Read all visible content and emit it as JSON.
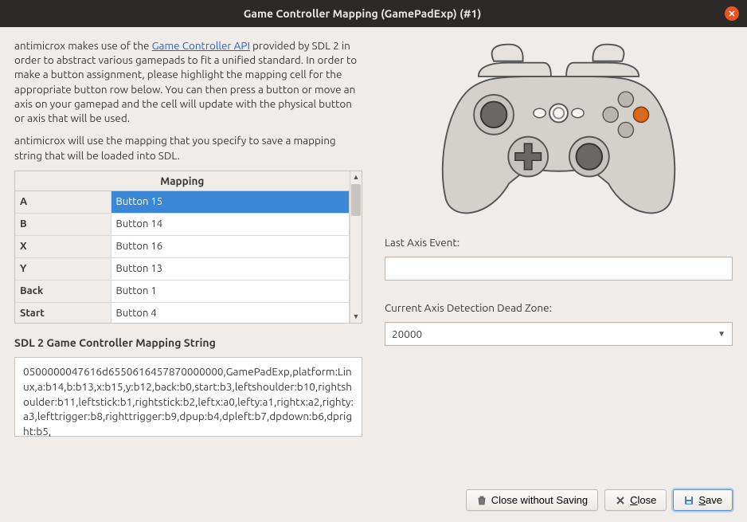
{
  "window": {
    "title": "Game Controller Mapping (GamePadExp) (#1)"
  },
  "intro": {
    "part1": "antimicrox makes use of the ",
    "link": "Game Controller API",
    "part2": " provided by SDL 2 in order to abstract various gamepads to fit a unified standard. In order to make a button assignment, please highlight the mapping cell for the appropriate button row below. You can then press a button or move an axis on your gamepad and the cell will update with the physical button or axis that will be used.",
    "part3": "antimicrox will use the mapping that you specify to save a mapping string that will be loaded into SDL."
  },
  "table": {
    "header": "Mapping",
    "rows": [
      {
        "name": "A",
        "value": "Button 15",
        "selected": true
      },
      {
        "name": "B",
        "value": "Button 14",
        "selected": false
      },
      {
        "name": "X",
        "value": "Button 16",
        "selected": false
      },
      {
        "name": "Y",
        "value": "Button 13",
        "selected": false
      },
      {
        "name": "Back",
        "value": "Button 1",
        "selected": false
      },
      {
        "name": "Start",
        "value": "Button 4",
        "selected": false
      }
    ]
  },
  "mapping": {
    "label": "SDL 2 Game Controller Mapping String",
    "value": "0500000047616d6550616457870000000,GamePadExp,platform:Linux,a:b14,b:b13,x:b15,y:b12,back:b0,start:b3,leftshoulder:b10,rightshoulder:b11,leftstick:b1,rightstick:b2,leftx:a0,lefty:a1,rightx:a2,righty:a3,lefttrigger:b8,righttrigger:b9,dpup:b4,dpleft:b7,dpdown:b6,dpright:b5,"
  },
  "axis": {
    "last_label": "Last Axis Event:",
    "last_value": "",
    "deadzone_label": "Current Axis Detection Dead Zone:",
    "deadzone_value": "20000"
  },
  "buttons": {
    "close_no_save": "Close without Saving",
    "close": "Close",
    "save": "Save"
  }
}
